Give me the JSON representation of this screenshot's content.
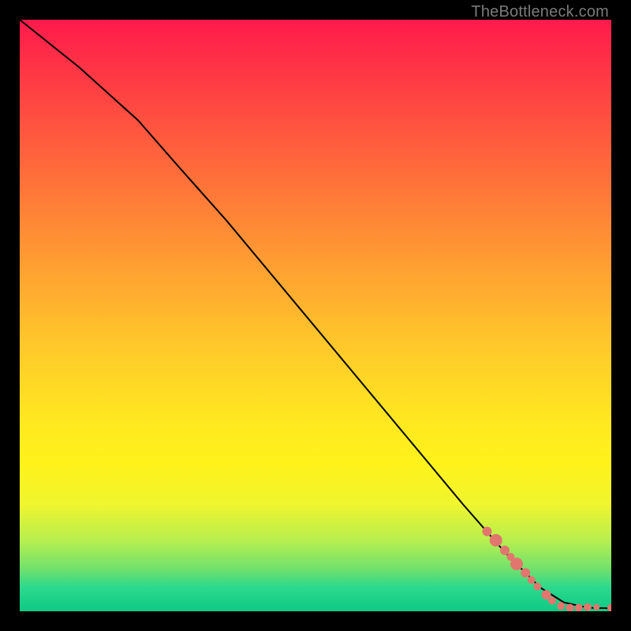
{
  "watermark": "TheBottleneck.com",
  "chart_data": {
    "type": "line",
    "title": "",
    "xlabel": "",
    "ylabel": "",
    "xlim": [
      0,
      100
    ],
    "ylim": [
      0,
      100
    ],
    "series": [
      {
        "name": "curve",
        "x": [
          0,
          10,
          20,
          27,
          35,
          45,
          55,
          65,
          75,
          82,
          88,
          92,
          96,
          100
        ],
        "y": [
          100,
          92,
          83,
          75,
          66,
          54,
          42,
          30,
          18,
          10,
          4,
          1.5,
          0.6,
          0.5
        ]
      }
    ],
    "scatter": {
      "name": "highlight-points",
      "color": "#e2766f",
      "points": [
        {
          "x": 79,
          "y": 13.5,
          "r": 6
        },
        {
          "x": 80.5,
          "y": 12,
          "r": 8
        },
        {
          "x": 82,
          "y": 10.3,
          "r": 6
        },
        {
          "x": 83,
          "y": 9.2,
          "r": 5
        },
        {
          "x": 84,
          "y": 8.0,
          "r": 8
        },
        {
          "x": 85.5,
          "y": 6.5,
          "r": 6
        },
        {
          "x": 86.5,
          "y": 5.3,
          "r": 5
        },
        {
          "x": 87.5,
          "y": 4.2,
          "r": 5
        },
        {
          "x": 89,
          "y": 2.8,
          "r": 6
        },
        {
          "x": 90,
          "y": 1.8,
          "r": 5
        },
        {
          "x": 91.5,
          "y": 0.9,
          "r": 5
        },
        {
          "x": 93,
          "y": 0.6,
          "r": 5
        },
        {
          "x": 94.5,
          "y": 0.6,
          "r": 5
        },
        {
          "x": 96,
          "y": 0.7,
          "r": 5
        },
        {
          "x": 97.5,
          "y": 0.7,
          "r": 4
        },
        {
          "x": 100,
          "y": 0.6,
          "r": 5
        }
      ]
    }
  }
}
